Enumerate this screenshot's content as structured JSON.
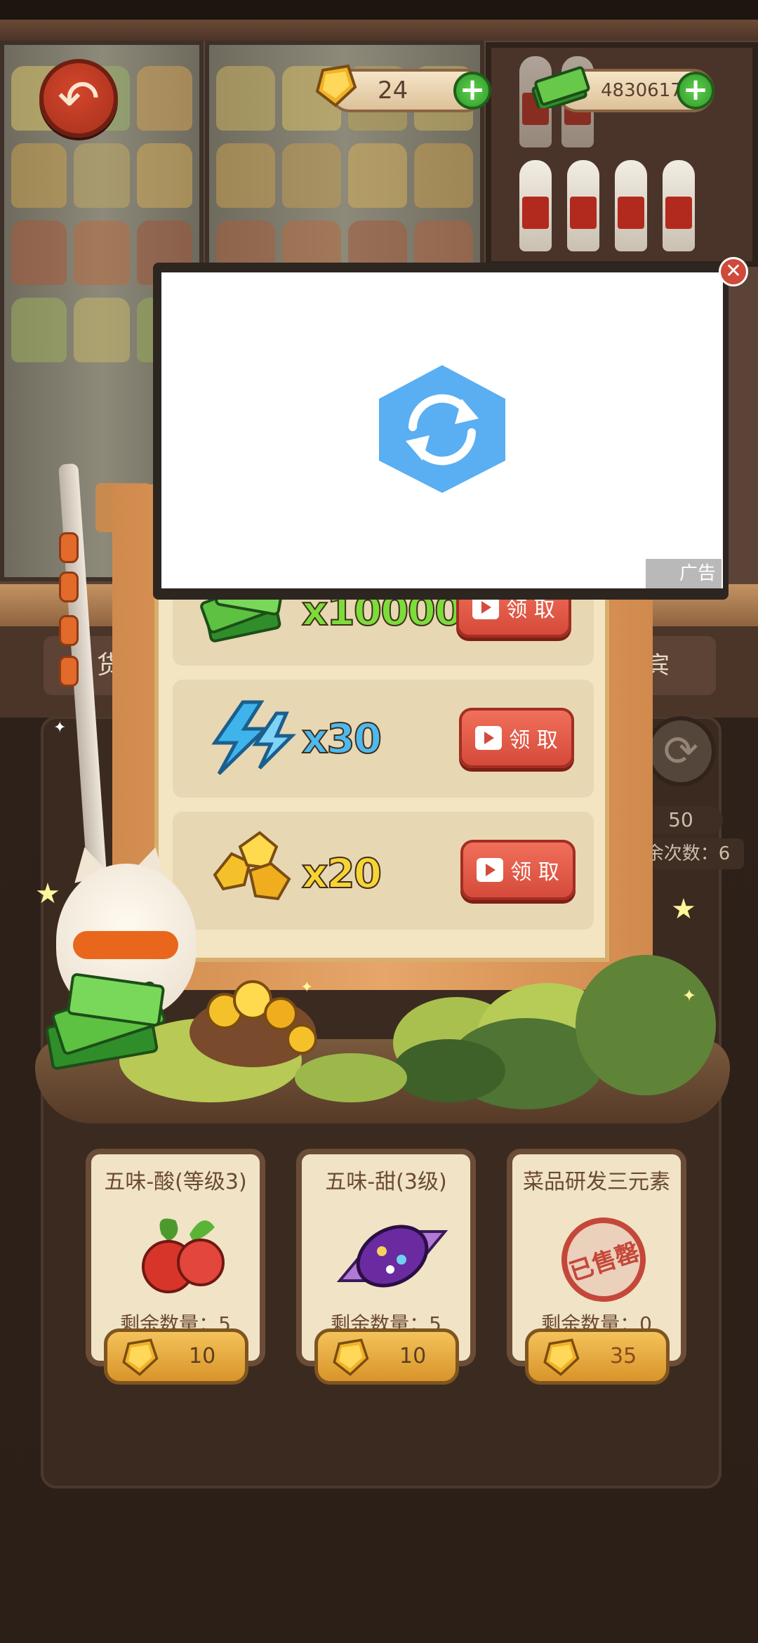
{
  "hud": {
    "gem_count": "24",
    "cash_count": "48306179",
    "plus_label": "+",
    "back_icon": "↶"
  },
  "background": {
    "tab_left_label": "货",
    "tab_right_label": "宾",
    "refresh_cost": "50",
    "remaining_times": "余次数：6"
  },
  "ad": {
    "label": "广告",
    "close_icon": "✕"
  },
  "rewards": [
    {
      "amount": "x100000",
      "type": "cash-bundle-icon",
      "claim_label": "领 取"
    },
    {
      "amount": "x30",
      "type": "lightning-icon",
      "claim_label": "领 取"
    },
    {
      "amount": "x20",
      "type": "gold-nuggets-icon",
      "claim_label": "领 取"
    }
  ],
  "shop": [
    {
      "title": "五味-酸(等级3)",
      "remaining": "剩余数量：5",
      "price": "10",
      "icon": "fruit-icon",
      "sold_out": false
    },
    {
      "title": "五味-甜(3级)",
      "remaining": "剩余数量：5",
      "price": "10",
      "icon": "candy-icon",
      "sold_out": false
    },
    {
      "title": "菜品研发三元素",
      "remaining": "剩余数量：0",
      "price": "35",
      "icon": "sold-out-stamp-icon",
      "sold_out": true,
      "stamp_label": "已售罄"
    }
  ],
  "colors": {
    "accent_red": "#d54a3a",
    "gold": "#f4c25a",
    "green_plus": "#2f9a29"
  }
}
